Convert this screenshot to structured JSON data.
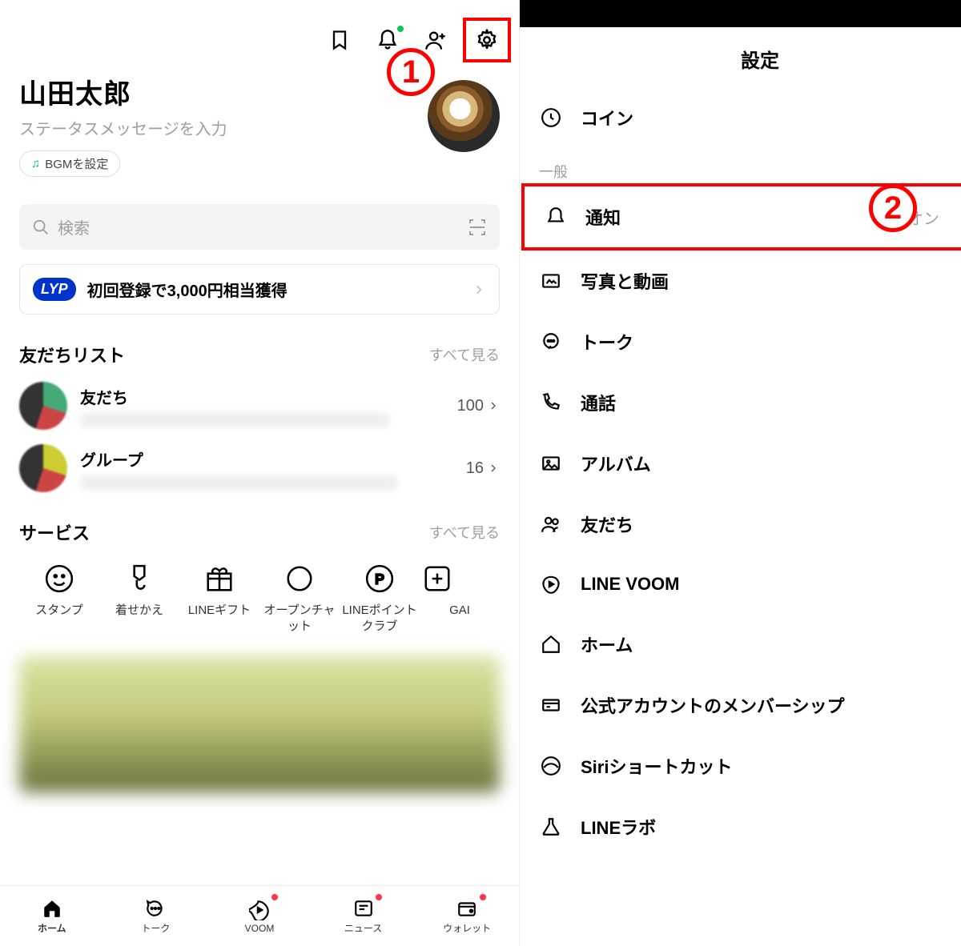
{
  "annotations": {
    "badge1": "1",
    "badge2": "2"
  },
  "left": {
    "profile": {
      "name": "山田太郎",
      "status_placeholder": "ステータスメッセージを入力",
      "bgm_label": "BGMを設定"
    },
    "search_placeholder": "検索",
    "lyp": {
      "badge": "LYP",
      "text": "初回登録で3,000円相当獲得"
    },
    "friends": {
      "section_title": "友だちリスト",
      "see_all": "すべて見る",
      "rows": [
        {
          "title": "友だち",
          "count": "100"
        },
        {
          "title": "グループ",
          "count": "16"
        }
      ]
    },
    "services": {
      "section_title": "サービス",
      "see_all": "すべて見る",
      "items": [
        {
          "label": "スタンプ"
        },
        {
          "label": "着せかえ"
        },
        {
          "label": "LINEギフト"
        },
        {
          "label": "オープンチャット"
        },
        {
          "label": "LINEポイントクラブ"
        },
        {
          "label": "GAI"
        }
      ]
    },
    "tabs": [
      {
        "label": "ホーム"
      },
      {
        "label": "トーク"
      },
      {
        "label": "VOOM"
      },
      {
        "label": "ニュース"
      },
      {
        "label": "ウォレット"
      }
    ]
  },
  "right": {
    "title": "設定",
    "coin_label": "コイン",
    "general_label": "一般",
    "rows": [
      {
        "label": "通知",
        "status": "オン"
      },
      {
        "label": "写真と動画"
      },
      {
        "label": "トーク"
      },
      {
        "label": "通話"
      },
      {
        "label": "アルバム"
      },
      {
        "label": "友だち"
      },
      {
        "label": "LINE VOOM"
      },
      {
        "label": "ホーム"
      },
      {
        "label": "公式アカウントのメンバーシップ"
      },
      {
        "label": "Siriショートカット"
      },
      {
        "label": "LINEラボ"
      }
    ]
  }
}
